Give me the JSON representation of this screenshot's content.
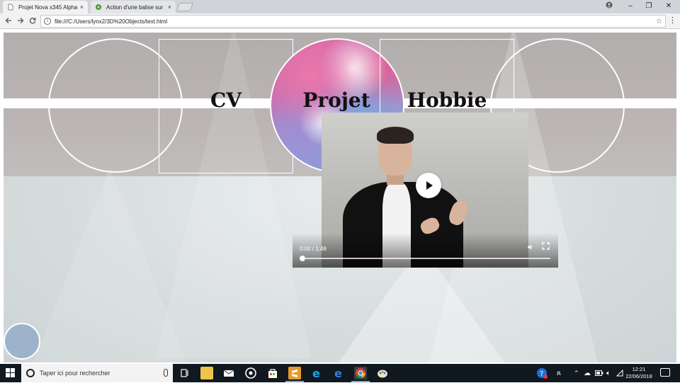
{
  "browser": {
    "tabs": [
      {
        "title": "Projet Nova x345 Alpha o",
        "active": true
      },
      {
        "title": "Action d'une balise sur u",
        "active": false
      }
    ],
    "close_glyph": "×",
    "address": "file:///C:/Users/lynx2/3D%20Objects/text.html",
    "window_controls": {
      "minimize": "–",
      "maximize": "❐",
      "close": "✕"
    }
  },
  "page": {
    "nav": [
      {
        "label": "CV"
      },
      {
        "label": "Projet"
      },
      {
        "label": "Hobbie"
      }
    ],
    "video": {
      "time": "0:00 / 1:48",
      "progress": 0.0
    }
  },
  "taskbar": {
    "search_placeholder": "Taper ici pour rechercher",
    "clock_time": "12:21",
    "clock_date": "22/06/2018",
    "pinned": [
      "task-view-icon",
      "file-explorer-icon",
      "mail-icon",
      "media-icon",
      "store-icon",
      "sublime-icon",
      "ie-icon",
      "edge-icon",
      "chrome-icon",
      "paint-icon"
    ]
  },
  "colors": {
    "chrome_tabstrip": "#d0d3d8",
    "taskbar": "#101820",
    "band": "#ffffff",
    "blue_circle": "#9db3cc"
  }
}
